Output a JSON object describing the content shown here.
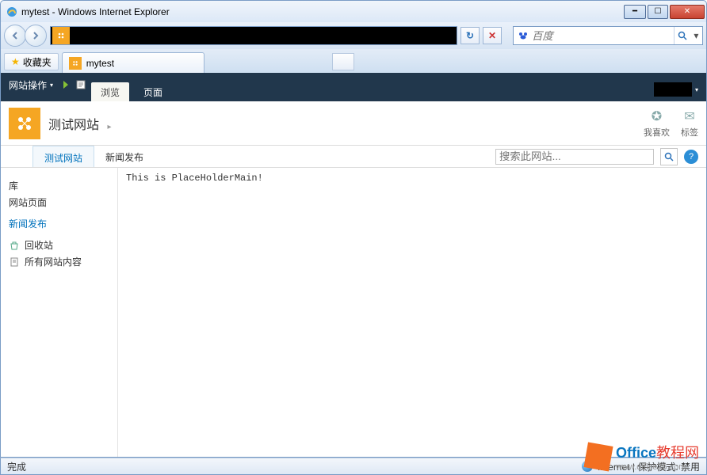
{
  "window": {
    "title": "mytest - Windows Internet Explorer"
  },
  "favorites_label": "收藏夹",
  "tab": {
    "title": "mytest"
  },
  "search": {
    "provider_placeholder": "百度"
  },
  "sp": {
    "ribbon": {
      "site_actions": "网站操作",
      "tab_browse": "浏览",
      "tab_page": "页面"
    },
    "header": {
      "site_title": "测试网站",
      "like": "我喜欢",
      "tags": "标签"
    },
    "topnav": {
      "item_active": "测试网站",
      "item2": "新闻发布",
      "search_placeholder": "搜索此网站..."
    },
    "leftnav": {
      "lib": "库",
      "pages": "网站页面",
      "news": "新闻发布",
      "recycle": "回收站",
      "allcontent": "所有网站内容"
    },
    "content": "This is PlaceHolderMain!"
  },
  "status": {
    "done": "完成",
    "zone": "Internet | 保护模式: 禁用"
  },
  "watermark": {
    "line1a": "Office",
    "line1b": "教程网",
    "line2": "www.office26.com"
  }
}
